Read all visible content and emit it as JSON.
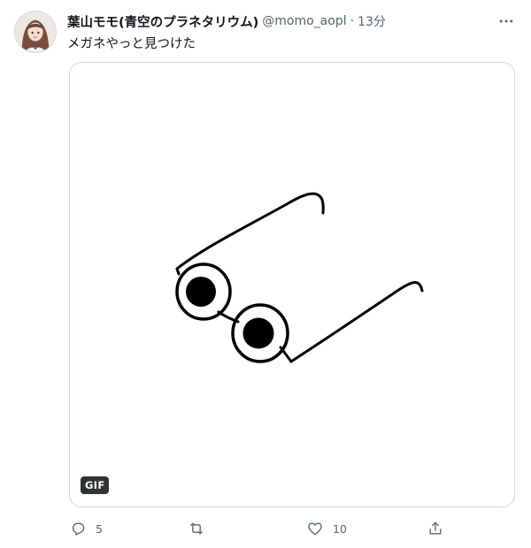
{
  "tweet": {
    "display_name": "葉山モモ(青空のプラネタリウム)",
    "handle": "@momo_aopl",
    "separator": "·",
    "time": "13分",
    "text": "メガネやっと見つけた",
    "media": {
      "badge": "GIF",
      "description_icon": "glasses-drawing"
    },
    "actions": {
      "reply": {
        "icon": "reply-icon",
        "count": "5"
      },
      "retweet": {
        "icon": "retweet-icon",
        "count": ""
      },
      "like": {
        "icon": "heart-icon",
        "count": "10"
      },
      "share": {
        "icon": "share-icon",
        "count": ""
      }
    },
    "more_icon": "more-icon"
  },
  "colors": {
    "text_primary": "#0f1419",
    "text_secondary": "#536471",
    "border": "#cfd9de",
    "badge_bg": "#2f3336"
  }
}
